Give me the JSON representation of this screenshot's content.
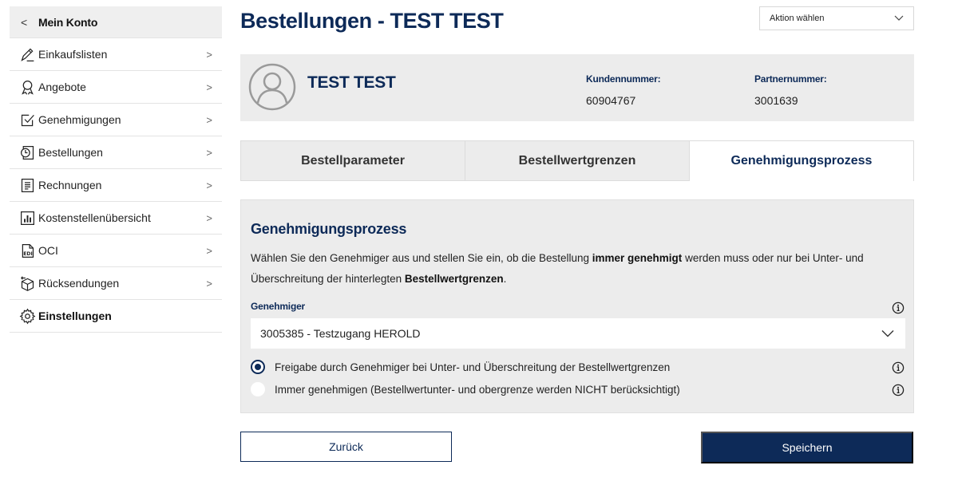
{
  "sidebar": {
    "header": {
      "back_icon": "chevron-left-icon",
      "title": "Mein Konto"
    },
    "items": [
      {
        "label": "Einkaufslisten",
        "icon": "pencil-list-icon"
      },
      {
        "label": "Angebote",
        "icon": "rosette-icon"
      },
      {
        "label": "Genehmigungen",
        "icon": "checkbox-icon"
      },
      {
        "label": "Bestellungen",
        "icon": "clock-document-icon"
      },
      {
        "label": "Rechnungen",
        "icon": "invoice-icon"
      },
      {
        "label": "Kostenstellenübersicht",
        "icon": "bar-chart-icon"
      },
      {
        "label": "OCI",
        "icon": "edi-icon"
      },
      {
        "label": "Rücksendungen",
        "icon": "return-box-icon"
      },
      {
        "label": "Einstellungen",
        "icon": "gear-icon",
        "active": true
      }
    ]
  },
  "header": {
    "title": "Bestellungen - TEST TEST",
    "action_select": "Aktion wählen"
  },
  "customer": {
    "name": "TEST TEST",
    "customer_number_label": "Kundennummer:",
    "customer_number": "60904767",
    "partner_number_label": "Partnernummer:",
    "partner_number": "3001639"
  },
  "tabs": [
    {
      "label": "Bestellparameter",
      "active": false
    },
    {
      "label": "Bestellwertgrenzen",
      "active": false
    },
    {
      "label": "Genehmigungsprozess",
      "active": true
    }
  ],
  "panel": {
    "title": "Genehmigungsprozess",
    "desc_1": "Wählen Sie den Genehmiger aus und stellen Sie ein, ob die Bestellung ",
    "desc_bold_1": "immer genehmigt",
    "desc_2": " werden muss oder nur bei Unter- und Überschreitung der hinterlegten ",
    "desc_bold_2": "Bestellwertgrenzen",
    "desc_3": ".",
    "approver_label": "Genehmiger",
    "approver_value": "3005385 - Testzugang HEROLD",
    "options": [
      {
        "label": "Freigabe durch Genehmiger bei Unter- und Überschreitung der Bestellwertgrenzen",
        "checked": true
      },
      {
        "label": "Immer genehmigen (Bestellwertunter- und obergrenze werden NICHT berücksichtigt)",
        "checked": false
      }
    ]
  },
  "buttons": {
    "back": "Zurück",
    "save": "Speichern"
  },
  "colors": {
    "brand": "#0d2a58",
    "panel_bg": "#ececec"
  }
}
